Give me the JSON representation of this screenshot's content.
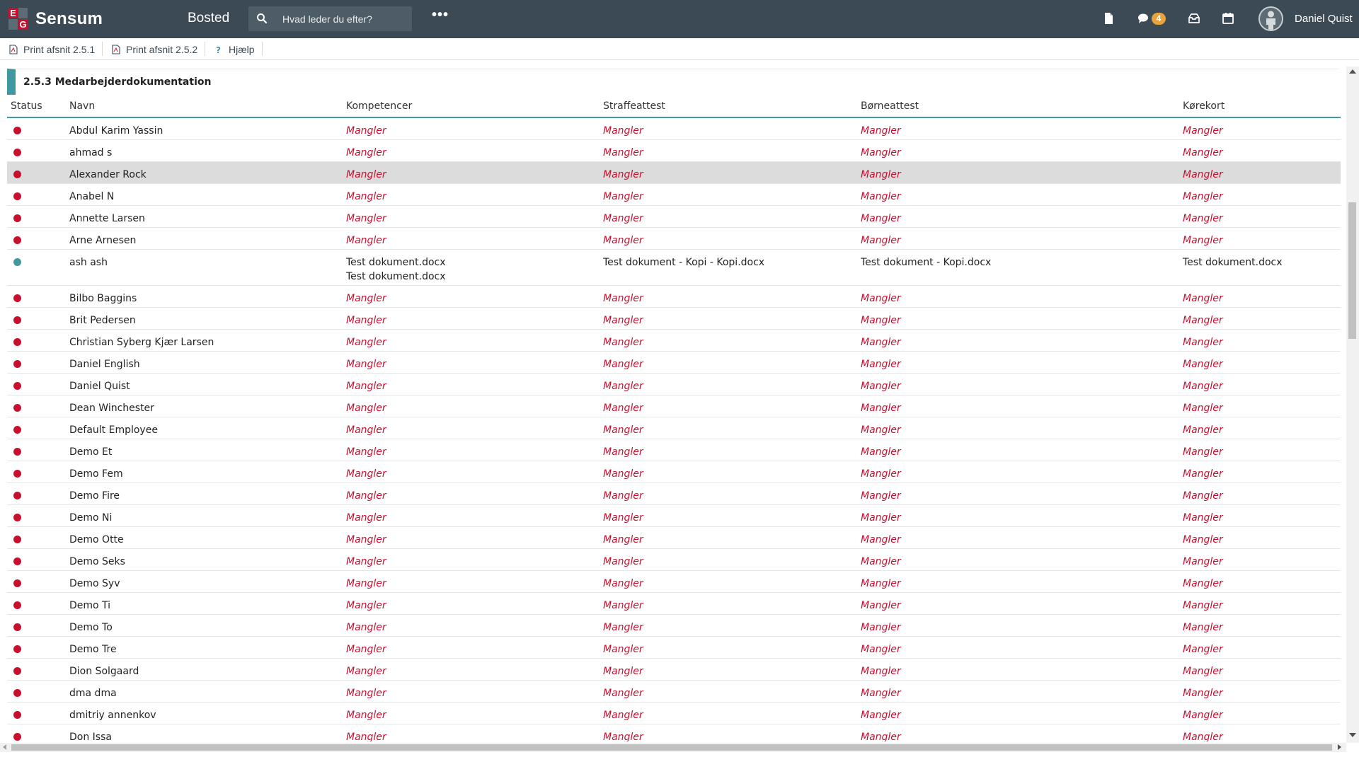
{
  "brand": {
    "logo_letters": [
      "E",
      "G"
    ],
    "name": "Sensum"
  },
  "header": {
    "module": "Bosted",
    "search_placeholder": "Hvad leder du efter?",
    "more_label": "•••",
    "messages_count": "4",
    "user_name": "Daniel Quist"
  },
  "toolbar": {
    "print_251": "Print afsnit 2.5.1",
    "print_252": "Print afsnit 2.5.2",
    "help": "Hjælp"
  },
  "section": {
    "title": "2.5.3 Medarbejderdokumentation"
  },
  "columns": {
    "status": "Status",
    "name": "Navn",
    "competencies": "Kompetencer",
    "criminal_record": "Straffeattest",
    "child_certificate": "Børneattest",
    "drivers_license": "Kørekort"
  },
  "colors": {
    "status_missing": "#c8102e",
    "status_ok": "#3f9aa0",
    "accent": "#3f9aa0",
    "topbar": "#3b4a54"
  },
  "rows": [
    {
      "status": "missing",
      "name": "Abdul Karim Yassin",
      "competencies": [
        "Mangler"
      ],
      "criminal_record": "Mangler",
      "child_certificate": "Mangler",
      "drivers_license": "Mangler"
    },
    {
      "status": "missing",
      "name": "ahmad s",
      "competencies": [
        "Mangler"
      ],
      "criminal_record": "Mangler",
      "child_certificate": "Mangler",
      "drivers_license": "Mangler"
    },
    {
      "status": "missing",
      "name": "Alexander Rock",
      "selected": true,
      "competencies": [
        "Mangler"
      ],
      "criminal_record": "Mangler",
      "child_certificate": "Mangler",
      "drivers_license": "Mangler"
    },
    {
      "status": "missing",
      "name": "Anabel N",
      "competencies": [
        "Mangler"
      ],
      "criminal_record": "Mangler",
      "child_certificate": "Mangler",
      "drivers_license": "Mangler"
    },
    {
      "status": "missing",
      "name": "Annette Larsen",
      "competencies": [
        "Mangler"
      ],
      "criminal_record": "Mangler",
      "child_certificate": "Mangler",
      "drivers_license": "Mangler"
    },
    {
      "status": "missing",
      "name": "Arne Arnesen",
      "competencies": [
        "Mangler"
      ],
      "criminal_record": "Mangler",
      "child_certificate": "Mangler",
      "drivers_license": "Mangler"
    },
    {
      "status": "ok",
      "name": "ash ash",
      "competencies": [
        "Test dokument.docx",
        "Test dokument.docx"
      ],
      "criminal_record": "Test dokument - Kopi - Kopi.docx",
      "child_certificate": "Test dokument - Kopi.docx",
      "drivers_license": "Test dokument.docx"
    },
    {
      "status": "missing",
      "name": "Bilbo Baggins",
      "competencies": [
        "Mangler"
      ],
      "criminal_record": "Mangler",
      "child_certificate": "Mangler",
      "drivers_license": "Mangler"
    },
    {
      "status": "missing",
      "name": "Brit Pedersen",
      "competencies": [
        "Mangler"
      ],
      "criminal_record": "Mangler",
      "child_certificate": "Mangler",
      "drivers_license": "Mangler"
    },
    {
      "status": "missing",
      "name": "Christian Syberg Kjær Larsen",
      "competencies": [
        "Mangler"
      ],
      "criminal_record": "Mangler",
      "child_certificate": "Mangler",
      "drivers_license": "Mangler"
    },
    {
      "status": "missing",
      "name": "Daniel English",
      "competencies": [
        "Mangler"
      ],
      "criminal_record": "Mangler",
      "child_certificate": "Mangler",
      "drivers_license": "Mangler"
    },
    {
      "status": "missing",
      "name": "Daniel Quist",
      "competencies": [
        "Mangler"
      ],
      "criminal_record": "Mangler",
      "child_certificate": "Mangler",
      "drivers_license": "Mangler"
    },
    {
      "status": "missing",
      "name": "Dean Winchester",
      "competencies": [
        "Mangler"
      ],
      "criminal_record": "Mangler",
      "child_certificate": "Mangler",
      "drivers_license": "Mangler"
    },
    {
      "status": "missing",
      "name": "Default Employee",
      "competencies": [
        "Mangler"
      ],
      "criminal_record": "Mangler",
      "child_certificate": "Mangler",
      "drivers_license": "Mangler"
    },
    {
      "status": "missing",
      "name": "Demo Et",
      "competencies": [
        "Mangler"
      ],
      "criminal_record": "Mangler",
      "child_certificate": "Mangler",
      "drivers_license": "Mangler"
    },
    {
      "status": "missing",
      "name": "Demo Fem",
      "competencies": [
        "Mangler"
      ],
      "criminal_record": "Mangler",
      "child_certificate": "Mangler",
      "drivers_license": "Mangler"
    },
    {
      "status": "missing",
      "name": "Demo Fire",
      "competencies": [
        "Mangler"
      ],
      "criminal_record": "Mangler",
      "child_certificate": "Mangler",
      "drivers_license": "Mangler"
    },
    {
      "status": "missing",
      "name": "Demo Ni",
      "competencies": [
        "Mangler"
      ],
      "criminal_record": "Mangler",
      "child_certificate": "Mangler",
      "drivers_license": "Mangler"
    },
    {
      "status": "missing",
      "name": "Demo Otte",
      "competencies": [
        "Mangler"
      ],
      "criminal_record": "Mangler",
      "child_certificate": "Mangler",
      "drivers_license": "Mangler"
    },
    {
      "status": "missing",
      "name": "Demo Seks",
      "competencies": [
        "Mangler"
      ],
      "criminal_record": "Mangler",
      "child_certificate": "Mangler",
      "drivers_license": "Mangler"
    },
    {
      "status": "missing",
      "name": "Demo Syv",
      "competencies": [
        "Mangler"
      ],
      "criminal_record": "Mangler",
      "child_certificate": "Mangler",
      "drivers_license": "Mangler"
    },
    {
      "status": "missing",
      "name": "Demo Ti",
      "competencies": [
        "Mangler"
      ],
      "criminal_record": "Mangler",
      "child_certificate": "Mangler",
      "drivers_license": "Mangler"
    },
    {
      "status": "missing",
      "name": "Demo To",
      "competencies": [
        "Mangler"
      ],
      "criminal_record": "Mangler",
      "child_certificate": "Mangler",
      "drivers_license": "Mangler"
    },
    {
      "status": "missing",
      "name": "Demo Tre",
      "competencies": [
        "Mangler"
      ],
      "criminal_record": "Mangler",
      "child_certificate": "Mangler",
      "drivers_license": "Mangler"
    },
    {
      "status": "missing",
      "name": "Dion Solgaard",
      "competencies": [
        "Mangler"
      ],
      "criminal_record": "Mangler",
      "child_certificate": "Mangler",
      "drivers_license": "Mangler"
    },
    {
      "status": "missing",
      "name": "dma dma",
      "competencies": [
        "Mangler"
      ],
      "criminal_record": "Mangler",
      "child_certificate": "Mangler",
      "drivers_license": "Mangler"
    },
    {
      "status": "missing",
      "name": "dmitriy annenkov",
      "competencies": [
        "Mangler"
      ],
      "criminal_record": "Mangler",
      "child_certificate": "Mangler",
      "drivers_license": "Mangler"
    },
    {
      "status": "missing",
      "name": "Don Issa",
      "competencies": [
        "Mangler"
      ],
      "criminal_record": "Mangler",
      "child_certificate": "Mangler",
      "drivers_license": "Mangler"
    }
  ]
}
